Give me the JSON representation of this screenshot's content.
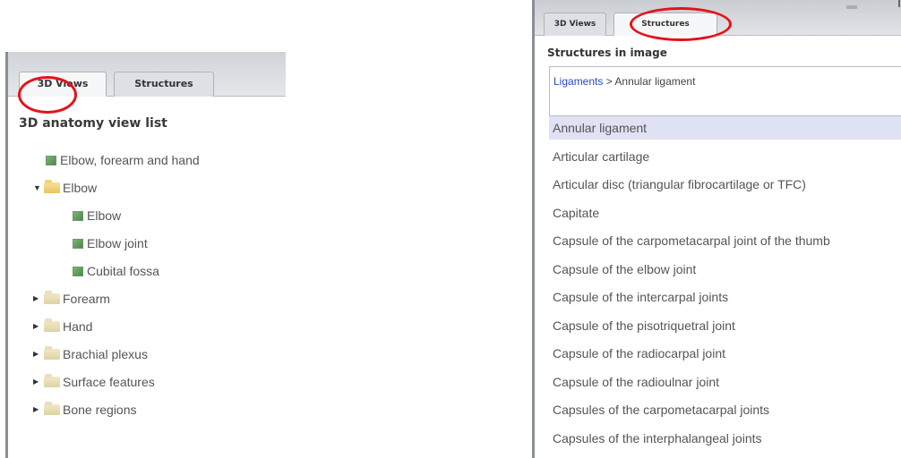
{
  "left": {
    "tabs": {
      "views": "3D Views",
      "structures": "Structures"
    },
    "title": "3D anatomy view list",
    "tree": [
      {
        "label": "Elbow, forearm and hand",
        "icon": "view-icon",
        "indent": 0
      },
      {
        "label": "Elbow",
        "icon": "folder-open-icon",
        "expand": "expanded",
        "indent": 0
      },
      {
        "label": "Elbow",
        "icon": "view-icon",
        "indent": 1
      },
      {
        "label": "Elbow joint",
        "icon": "view-icon",
        "indent": 1
      },
      {
        "label": "Cubital fossa",
        "icon": "view-icon",
        "indent": 1
      },
      {
        "label": "Forearm",
        "icon": "folder-icon",
        "expand": "collapsed",
        "indent": 0
      },
      {
        "label": "Hand",
        "icon": "folder-icon",
        "expand": "collapsed",
        "indent": 0
      },
      {
        "label": "Brachial plexus",
        "icon": "folder-icon",
        "expand": "collapsed",
        "indent": 0
      },
      {
        "label": "Surface features",
        "icon": "folder-icon",
        "expand": "collapsed",
        "indent": 0
      },
      {
        "label": "Bone regions",
        "icon": "folder-icon",
        "expand": "collapsed",
        "indent": 0
      }
    ]
  },
  "right": {
    "tabs": {
      "views": "3D Views",
      "structures": "Structures"
    },
    "title": "Structures in image",
    "info": {
      "link": "Ligaments",
      "separator": " > ",
      "value": "Annular ligament"
    },
    "items": [
      "Annular ligament",
      "Articular cartilage",
      "Articular disc (triangular fibrocartilage or TFC)",
      "Capitate",
      "Capsule of the carpometacarpal joint of the thumb",
      "Capsule of the elbow joint",
      "Capsule of the intercarpal joints",
      "Capsule of the pisotriquetral joint",
      "Capsule of the radiocarpal joint",
      "Capsule of the radioulnar joint",
      "Capsules of the carpometacarpal joints",
      "Capsules of the interphalangeal joints"
    ],
    "selected_index": 0
  },
  "colors": {
    "highlight_oval": "#e3131b",
    "link": "#2b47c6",
    "selection": "#dfe1f4"
  }
}
